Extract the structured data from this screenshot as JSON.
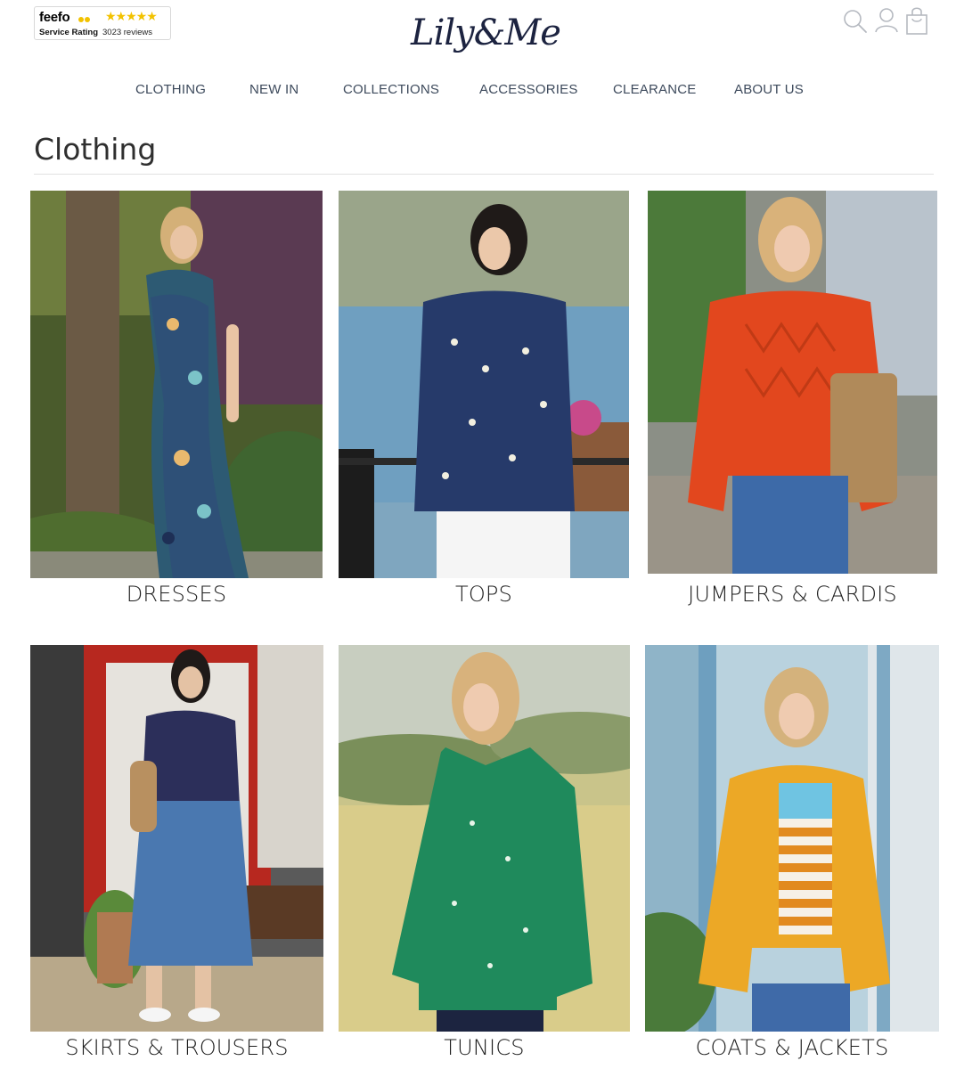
{
  "feefo": {
    "brand": "feefo",
    "stars": "★★★★★",
    "label": "Service Rating",
    "reviews": "3023 reviews"
  },
  "logo": {
    "text": "Lily&Me"
  },
  "header_icons": [
    "search-icon",
    "account-icon",
    "shopping-bag-icon"
  ],
  "nav": {
    "items": [
      {
        "label": "CLOTHING"
      },
      {
        "label": "NEW IN"
      },
      {
        "label": "COLLECTIONS"
      },
      {
        "label": "ACCESSORIES"
      },
      {
        "label": "CLEARANCE"
      },
      {
        "label": "ABOUT US"
      }
    ]
  },
  "page": {
    "title": "Clothing"
  },
  "categories": [
    {
      "label": "DRESSES"
    },
    {
      "label": "TOPS"
    },
    {
      "label": "JUMPERS & CARDIS"
    },
    {
      "label": "SKIRTS & TROUSERS"
    },
    {
      "label": "TUNICS"
    },
    {
      "label": "COATS & JACKETS"
    }
  ],
  "colors": {
    "nav_text": "#3d4a5c",
    "logo": "#1c2340",
    "feefo_star": "#f2c200"
  }
}
